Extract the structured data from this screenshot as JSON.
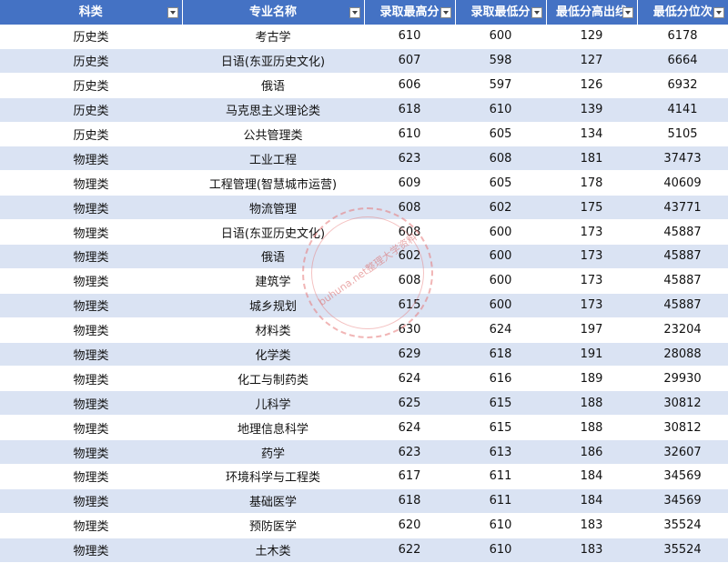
{
  "headers": [
    "科类",
    "专业名称",
    "录取最高分",
    "录取最低分",
    "最低分高出线",
    "最低分位次"
  ],
  "rows": [
    [
      "历史类",
      "考古学",
      "610",
      "600",
      "129",
      "6178"
    ],
    [
      "历史类",
      "日语(东亚历史文化)",
      "607",
      "598",
      "127",
      "6664"
    ],
    [
      "历史类",
      "俄语",
      "606",
      "597",
      "126",
      "6932"
    ],
    [
      "历史类",
      "马克思主义理论类",
      "618",
      "610",
      "139",
      "4141"
    ],
    [
      "历史类",
      "公共管理类",
      "610",
      "605",
      "134",
      "5105"
    ],
    [
      "物理类",
      "工业工程",
      "623",
      "608",
      "181",
      "37473"
    ],
    [
      "物理类",
      "工程管理(智慧城市运营)",
      "609",
      "605",
      "178",
      "40609"
    ],
    [
      "物理类",
      "物流管理",
      "608",
      "602",
      "175",
      "43771"
    ],
    [
      "物理类",
      "日语(东亚历史文化)",
      "608",
      "600",
      "173",
      "45887"
    ],
    [
      "物理类",
      "俄语",
      "602",
      "600",
      "173",
      "45887"
    ],
    [
      "物理类",
      "建筑学",
      "608",
      "600",
      "173",
      "45887"
    ],
    [
      "物理类",
      "城乡规划",
      "615",
      "600",
      "173",
      "45887"
    ],
    [
      "物理类",
      "材料类",
      "630",
      "624",
      "197",
      "23204"
    ],
    [
      "物理类",
      "化学类",
      "629",
      "618",
      "191",
      "28088"
    ],
    [
      "物理类",
      "化工与制药类",
      "624",
      "616",
      "189",
      "29930"
    ],
    [
      "物理类",
      "儿科学",
      "625",
      "615",
      "188",
      "30812"
    ],
    [
      "物理类",
      "地理信息科学",
      "624",
      "615",
      "188",
      "30812"
    ],
    [
      "物理类",
      "药学",
      "623",
      "613",
      "186",
      "32607"
    ],
    [
      "物理类",
      "环境科学与工程类",
      "617",
      "611",
      "184",
      "34569"
    ],
    [
      "物理类",
      "基础医学",
      "618",
      "611",
      "184",
      "34569"
    ],
    [
      "物理类",
      "预防医学",
      "620",
      "610",
      "183",
      "35524"
    ],
    [
      "物理类",
      "土木类",
      "622",
      "610",
      "183",
      "35524"
    ]
  ],
  "watermark": "buhuna.net整理大学资料",
  "icons": {
    "filter": "filter-dropdown-icon"
  },
  "colors": {
    "header_bg": "#4472c4",
    "row_alt": "#dae3f3"
  }
}
